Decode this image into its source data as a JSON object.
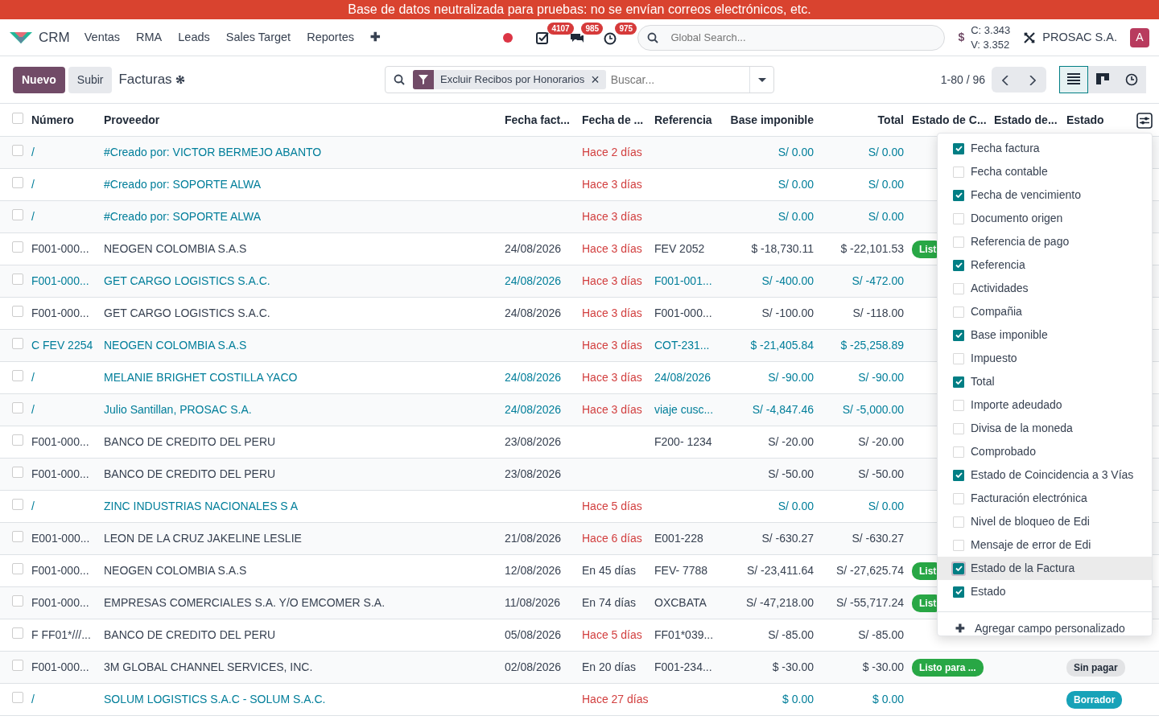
{
  "banner": "Base de datos neutralizada para pruebas: no se envían correos electrónicos, etc.",
  "navbar": {
    "app": "CRM",
    "menu": [
      "Ventas",
      "RMA",
      "Leads",
      "Sales Target",
      "Reportes",
      "✚"
    ],
    "counters": [
      {
        "kind": "status"
      },
      {
        "kind": "check",
        "value": "4107"
      },
      {
        "kind": "chat",
        "value": "985"
      },
      {
        "kind": "clock",
        "value": "975"
      }
    ],
    "search_placeholder": "Global Search...",
    "currency": "$",
    "rates": [
      "C: 3.343",
      "V: 3.352"
    ],
    "company": "PROSAC S.A.",
    "avatar": "A"
  },
  "control_panel": {
    "buttons": [
      "Nuevo",
      "Subir"
    ],
    "title": "Facturas",
    "facet": "Excluir Recibos por Honorarios",
    "facet_remove": "×",
    "search_placeholder": "Buscar...",
    "pager": "1-80 / 96",
    "views": [
      {
        "kind": "list",
        "selected": true
      },
      {
        "kind": "kanban",
        "selected": false
      },
      {
        "kind": "activity",
        "selected": false
      }
    ]
  },
  "table": {
    "all_selected": false,
    "columns": [
      "Número",
      "Proveedor",
      "Fecha fact...",
      "Fecha de ...",
      "Referencia",
      "Base imponible",
      "Total",
      "Estado de C...",
      "Estado de...",
      "Estado"
    ],
    "rows": [
      {
        "cells": [
          "/",
          "#Creado por: VICTOR BERMEJO ABANTO",
          "",
          "Hace 2 días",
          "",
          "S/ 0.00",
          "S/ 0.00"
        ],
        "draft": true,
        "overdue": true,
        "selected": false
      },
      {
        "cells": [
          "/",
          "#Creado por: SOPORTE ALWA",
          "",
          "Hace 3 días",
          "",
          "S/ 0.00",
          "S/ 0.00"
        ],
        "draft": true,
        "overdue": true,
        "selected": false
      },
      {
        "cells": [
          "/",
          "#Creado por: SOPORTE ALWA",
          "",
          "Hace 3 días",
          "",
          "S/ 0.00",
          "S/ 0.00"
        ],
        "draft": true,
        "overdue": true,
        "selected": false
      },
      {
        "cells": [
          "F001-000...",
          "NEOGEN COLOMBIA S.A.S",
          "24/08/2026",
          "Hace 3 días",
          "FEV 2052",
          "$ -18,730.11",
          "$ -22,101.53"
        ],
        "draft": false,
        "overdue": true,
        "selected": false,
        "match_status": {
          "text": "List",
          "kind": "success"
        }
      },
      {
        "cells": [
          "F001-000...",
          "GET CARGO LOGISTICS S.A.C.",
          "24/08/2026",
          "Hace 3 días",
          "F001-001...",
          "S/ -400.00",
          "S/ -472.00"
        ],
        "draft": true,
        "overdue": true,
        "selected": false
      },
      {
        "cells": [
          "F001-000...",
          "GET CARGO LOGISTICS S.A.C.",
          "24/08/2026",
          "Hace 3 días",
          "F001-000...",
          "S/ -100.00",
          "S/ -118.00"
        ],
        "draft": false,
        "overdue": true,
        "selected": false
      },
      {
        "cells": [
          "C FEV 2254",
          "NEOGEN COLOMBIA S.A.S",
          "",
          "Hace 3 días",
          "COT-231...",
          "$ -21,405.84",
          "$ -25,258.89"
        ],
        "draft": true,
        "overdue": true,
        "selected": false
      },
      {
        "cells": [
          "/",
          "MELANIE BRIGHET COSTILLA YACO",
          "24/08/2026",
          "Hace 3 días",
          "24/08/2026",
          "S/ -90.00",
          "S/ -90.00"
        ],
        "draft": true,
        "overdue": true,
        "selected": false
      },
      {
        "cells": [
          "/",
          "Julio Santillan, PROSAC S.A.",
          "24/08/2026",
          "Hace 3 días",
          "viaje cusc...",
          "S/ -4,847.46",
          "S/ -5,000.00"
        ],
        "draft": true,
        "overdue": true,
        "selected": false
      },
      {
        "cells": [
          "F001-000...",
          "BANCO DE CREDITO DEL PERU",
          "23/08/2026",
          "",
          "F200- 1234",
          "S/ -20.00",
          "S/ -20.00"
        ],
        "draft": false,
        "selected": false
      },
      {
        "cells": [
          "F001-000...",
          "BANCO DE CREDITO DEL PERU",
          "23/08/2026",
          "",
          "",
          "S/ -50.00",
          "S/ -50.00"
        ],
        "draft": false,
        "selected": false
      },
      {
        "cells": [
          "/",
          "ZINC INDUSTRIAS NACIONALES S A",
          "",
          "Hace 5 días",
          "",
          "S/ 0.00",
          "S/ 0.00"
        ],
        "draft": true,
        "overdue": true,
        "selected": false
      },
      {
        "cells": [
          "E001-000...",
          "LEON DE LA CRUZ JAKELINE LESLIE",
          "21/08/2026",
          "Hace 6 días",
          "E001-228",
          "S/ -630.27",
          "S/ -630.27"
        ],
        "draft": false,
        "overdue": true,
        "selected": false
      },
      {
        "cells": [
          "F001-000...",
          "NEOGEN COLOMBIA S.A.S",
          "12/08/2026",
          "En 45 días",
          "FEV- 7788",
          "S/ -23,411.64",
          "S/ -27,625.74"
        ],
        "draft": false,
        "overdue": false,
        "selected": false,
        "match_status": {
          "text": "List",
          "kind": "success"
        }
      },
      {
        "cells": [
          "F001-000...",
          "EMPRESAS COMERCIALES S.A. Y/O EMCOMER S.A.",
          "11/08/2026",
          "En 74 días",
          "OXCBATA",
          "S/ -47,218.00",
          "S/ -55,717.24"
        ],
        "draft": false,
        "overdue": false,
        "selected": false,
        "match_status": {
          "text": "List",
          "kind": "success"
        }
      },
      {
        "cells": [
          "F FF01*///...",
          "BANCO DE CREDITO DEL PERU",
          "05/08/2026",
          "Hace 5 días",
          "FF01*039...",
          "S/ -85.00",
          "S/ -85.00"
        ],
        "draft": false,
        "overdue": true,
        "selected": false
      },
      {
        "cells": [
          "F001-000...",
          "3M GLOBAL CHANNEL SERVICES, INC.",
          "02/08/2026",
          "En 20 días",
          "F001-234...",
          "$ -30.00",
          "$ -30.00"
        ],
        "draft": false,
        "overdue": false,
        "selected": false,
        "match_status": {
          "text": "Listo para ...",
          "kind": "success"
        },
        "status": {
          "text": "Sin pagar",
          "kind": "secondary"
        }
      },
      {
        "cells": [
          "/",
          "SOLUM LOGISTICS S.A.C - SOLUM S.A.C.",
          "",
          "Hace 27 días",
          "",
          "$ 0.00",
          "$ 0.00"
        ],
        "draft": true,
        "overdue": true,
        "selected": false,
        "status": {
          "text": "Borrador",
          "kind": "info"
        }
      }
    ]
  },
  "column_menu": {
    "items": [
      {
        "label": "Fecha factura",
        "checked": true,
        "highlighted": false
      },
      {
        "label": "Fecha contable",
        "checked": false,
        "highlighted": false
      },
      {
        "label": "Fecha de vencimiento",
        "checked": true,
        "highlighted": false
      },
      {
        "label": "Documento origen",
        "checked": false,
        "highlighted": false
      },
      {
        "label": "Referencia de pago",
        "checked": false,
        "highlighted": false
      },
      {
        "label": "Referencia",
        "checked": true,
        "highlighted": false
      },
      {
        "label": "Actividades",
        "checked": false,
        "highlighted": false
      },
      {
        "label": "Compañia",
        "checked": false,
        "highlighted": false
      },
      {
        "label": "Base imponible",
        "checked": true,
        "highlighted": false
      },
      {
        "label": "Impuesto",
        "checked": false,
        "highlighted": false
      },
      {
        "label": "Total",
        "checked": true,
        "highlighted": false
      },
      {
        "label": "Importe adeudado",
        "checked": false,
        "highlighted": false
      },
      {
        "label": "Divisa de la moneda",
        "checked": false,
        "highlighted": false
      },
      {
        "label": "Comprobado",
        "checked": false,
        "highlighted": false
      },
      {
        "label": "Estado de Coincidencia a 3 Vías",
        "checked": true,
        "highlighted": false
      },
      {
        "label": "Facturación electrónica",
        "checked": false,
        "highlighted": false
      },
      {
        "label": "Nivel de bloqueo de Edi",
        "checked": false,
        "highlighted": false
      },
      {
        "label": "Mensaje de error de Edi",
        "checked": false,
        "highlighted": false
      },
      {
        "label": "Estado de la Factura",
        "checked": true,
        "highlighted": true
      },
      {
        "label": "Estado",
        "checked": true,
        "highlighted": false
      }
    ],
    "add_icon": "✚",
    "add_label": "Agregar campo personalizado"
  }
}
